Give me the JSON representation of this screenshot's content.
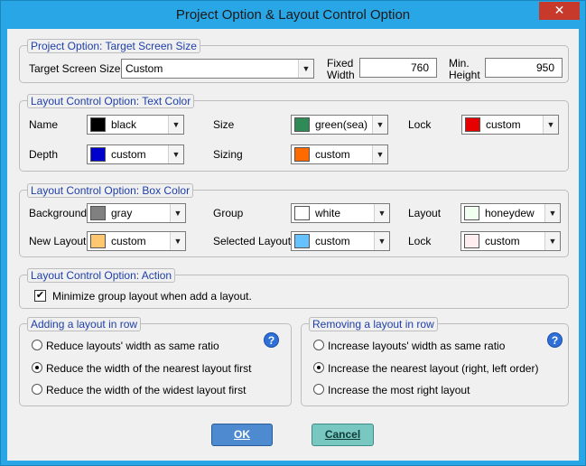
{
  "window": {
    "title": "Project Option & Layout Control Option",
    "close_glyph": "✕"
  },
  "target_screen": {
    "legend": "Project Option: Target Screen Size",
    "label": "Target Screen Size",
    "value": "Custom",
    "fixed_width_label_1": "Fixed",
    "fixed_width_label_2": "Width",
    "fixed_width": "760",
    "min_height_label_1": "Min.",
    "min_height_label_2": "Height",
    "min_height": "950"
  },
  "text_color": {
    "legend": "Layout Control Option: Text Color",
    "items": [
      {
        "label": "Name",
        "value": "black",
        "color": "#000000"
      },
      {
        "label": "Size",
        "value": "green(sea)",
        "color": "#2e8b57"
      },
      {
        "label": "Lock",
        "value": "custom",
        "color": "#e60000"
      },
      {
        "label": "Depth",
        "value": "custom",
        "color": "#0000cc"
      },
      {
        "label": "Sizing",
        "value": "custom",
        "color": "#ff6a00"
      }
    ]
  },
  "box_color": {
    "legend": "Layout Control Option: Box Color",
    "items": [
      {
        "label": "Background",
        "value": "gray",
        "color": "#808080"
      },
      {
        "label": "Group",
        "value": "white",
        "color": "#ffffff"
      },
      {
        "label": "Layout",
        "value": "honeydew",
        "color": "#f0fff0"
      },
      {
        "label": "New Layout",
        "value": "custom",
        "color": "#ffc870"
      },
      {
        "label": "Selected Layout",
        "value": "custom",
        "color": "#66c2ff"
      },
      {
        "label": "Lock",
        "value": "custom",
        "color": "#ffeef0"
      }
    ]
  },
  "action": {
    "legend": "Layout Control Option: Action",
    "checkbox_label": "Minimize group layout when add a layout.",
    "checked_glyph": "✔"
  },
  "adding": {
    "legend": "Adding a layout in row",
    "options": [
      "Reduce layouts' width as same ratio",
      "Reduce the width of the nearest layout first",
      "Reduce the width of the widest layout first"
    ],
    "selected_index": 1,
    "help": "?"
  },
  "removing": {
    "legend": "Removing a layout in row",
    "options": [
      "Increase layouts' width as same ratio",
      "Increase the nearest layout (right, left order)",
      "Increase the most right layout"
    ],
    "selected_index": 1,
    "help": "?"
  },
  "buttons": {
    "ok": "OK",
    "cancel": "Cancel"
  },
  "icons": {
    "dropdown": "▼"
  }
}
